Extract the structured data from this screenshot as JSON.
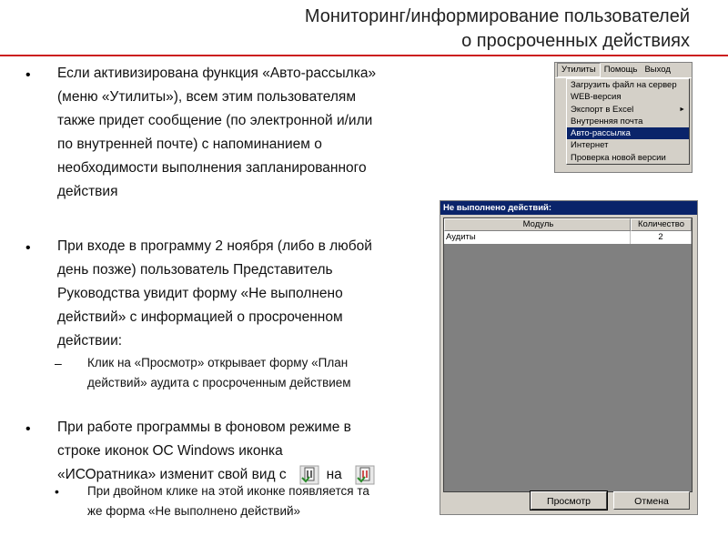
{
  "title": {
    "line1": "Мониторинг/информирование пользователей",
    "line2": "о просроченных действиях"
  },
  "bullets": [
    {
      "marker": "•",
      "lines": [
        "Если активизирована функция «Авто-рассылка»",
        "(меню «Утилиты»), всем этим пользователям",
        "также придет сообщение (по электронной и/или",
        "по внутренней  почте) с напоминанием о",
        "необходимости выполнения запланированного",
        "действия"
      ]
    },
    {
      "marker": "•",
      "lines": [
        "При входе в программу 2 ноября (либо в любой",
        "день позже) пользователь Представитель",
        "Руководства увидит форму «Не выполнено",
        "действий» с информацией о просроченном",
        "действии:"
      ],
      "sub": {
        "marker": "–",
        "lines": [
          "Клик на «Просмотр» открывает форму «План",
          "действий» аудита с просроченным действием"
        ]
      }
    },
    {
      "marker": "•",
      "lines": [
        "При работе программы в фоновом режиме в",
        "строке иконок ОС Windows иконка",
        "«ИСОратника» изменит свой вид с"
      ],
      "connector": "на",
      "icon_from": "iso-tray-icon-normal",
      "icon_to": "iso-tray-icon-alert",
      "sub": {
        "marker": "•",
        "lines": [
          "При двойном клике на этой иконке появляется та",
          "же форма «Не выполнено действий»"
        ]
      }
    }
  ],
  "menu": {
    "bar": [
      "Утилиты",
      "Помощь",
      "Выход"
    ],
    "items": [
      {
        "label": "Загрузить файл на сервер"
      },
      {
        "label": "WEB-версия"
      },
      {
        "label": "Экспорт в Excel",
        "submenu_arrow": "►"
      },
      {
        "label": "Внутренняя почта"
      },
      {
        "label": "Авто-рассылка",
        "selected": true
      },
      {
        "label": "Интернет"
      },
      {
        "label": "Проверка новой версии"
      }
    ]
  },
  "dialog": {
    "title": "Не выполнено действий:",
    "columns": [
      "Модуль",
      "Количество"
    ],
    "rows": [
      {
        "module": "Аудиты",
        "count": "2"
      }
    ],
    "buttons": {
      "view": "Просмотр",
      "cancel": "Отмена"
    }
  },
  "colors": {
    "accent_rule": "#cc1f1f",
    "win_face": "#d4d0c8",
    "win_titlebar": "#0a246a"
  }
}
